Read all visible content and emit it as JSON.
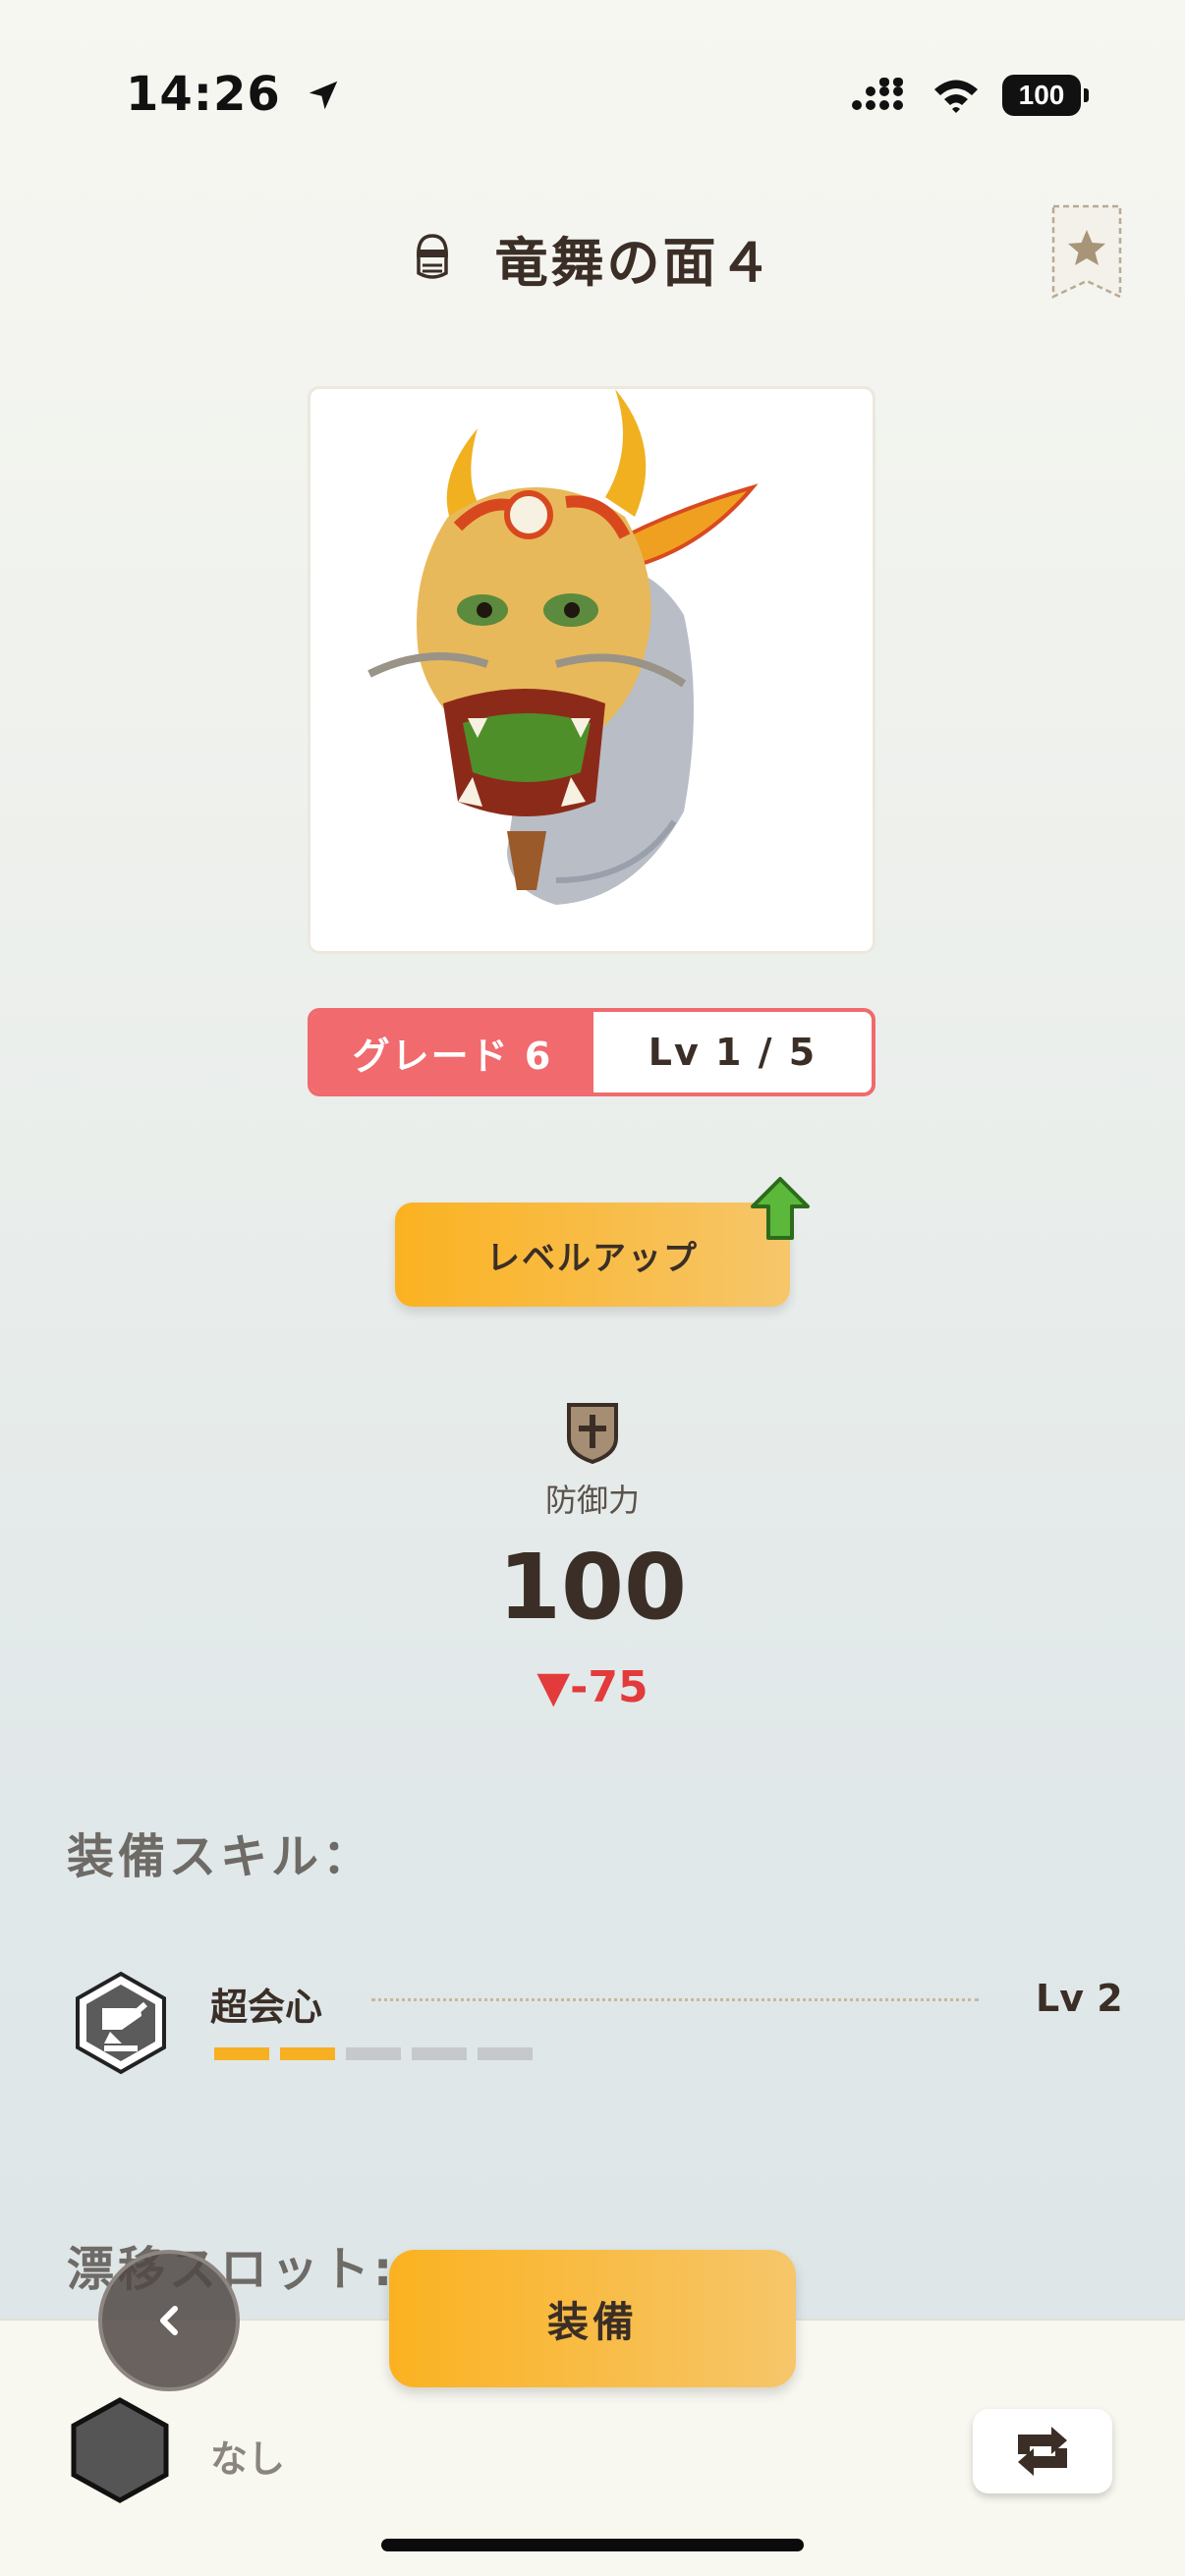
{
  "status_bar": {
    "time": "14:26",
    "battery": "100"
  },
  "header": {
    "title": "竜舞の面４"
  },
  "item": {
    "grade_label": "グレード 6",
    "level_label": "Lv 1 / 5"
  },
  "level_up": {
    "label": "レベルアップ"
  },
  "defense": {
    "label": "防御力",
    "value": "100",
    "diff": "▼-75"
  },
  "skills": {
    "section_title": "装備スキル：",
    "items": [
      {
        "name": "超会心",
        "level": "Lv 2",
        "filled": 2,
        "total": 5
      }
    ]
  },
  "drift_slot": {
    "section_title": "漂移スロット:",
    "value": "なし"
  },
  "actions": {
    "equip_label": "装備"
  },
  "colors": {
    "accent_orange": "#fbb221",
    "grade_red": "#f06a6e",
    "down_red": "#e33b3b"
  }
}
